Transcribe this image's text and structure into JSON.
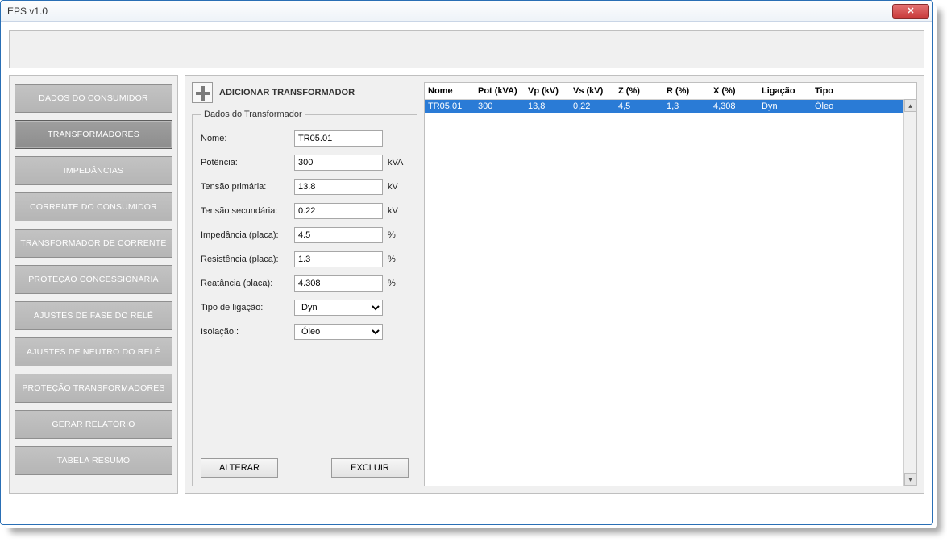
{
  "window": {
    "title": "EPS v1.0"
  },
  "sidebar": {
    "items": [
      {
        "label": "DADOS DO CONSUMIDOR",
        "active": false
      },
      {
        "label": "TRANSFORMADORES",
        "active": true
      },
      {
        "label": "IMPEDÂNCIAS",
        "active": false
      },
      {
        "label": "CORRENTE DO CONSUMIDOR",
        "active": false
      },
      {
        "label": "TRANSFORMADOR DE CORRENTE",
        "active": false
      },
      {
        "label": "PROTEÇÃO CONCESSIONÁRIA",
        "active": false
      },
      {
        "label": "AJUSTES DE FASE DO RELÉ",
        "active": false
      },
      {
        "label": "AJUSTES DE NEUTRO DO RELÉ",
        "active": false
      },
      {
        "label": "PROTEÇÃO TRANSFORMADORES",
        "active": false
      },
      {
        "label": "GERAR RELATÓRIO",
        "active": false
      },
      {
        "label": "TABELA RESUMO",
        "active": false
      }
    ]
  },
  "form": {
    "add_label": "ADICIONAR TRANSFORMADOR",
    "group_title": "Dados do Transformador",
    "fields": {
      "nome": {
        "label": "Nome:",
        "value": "TR05.01",
        "unit": ""
      },
      "potencia": {
        "label": "Potência:",
        "value": "300",
        "unit": "kVA"
      },
      "tprim": {
        "label": "Tensão primária:",
        "value": "13.8",
        "unit": "kV"
      },
      "tsec": {
        "label": "Tensão secundária:",
        "value": "0.22",
        "unit": "kV"
      },
      "imp": {
        "label": "Impedância (placa):",
        "value": "4.5",
        "unit": "%"
      },
      "res": {
        "label": "Resistência (placa):",
        "value": "1.3",
        "unit": "%"
      },
      "reat": {
        "label": "Reatância (placa):",
        "value": "4.308",
        "unit": "%"
      },
      "ligacao": {
        "label": "Tipo de ligação:",
        "value": "Dyn",
        "unit": ""
      },
      "isolacao": {
        "label": "Isolação::",
        "value": "Óleo",
        "unit": ""
      }
    },
    "buttons": {
      "alterar": "ALTERAR",
      "excluir": "EXCLUIR"
    }
  },
  "table": {
    "headers": [
      "Nome",
      "Pot (kVA)",
      "Vp (kV)",
      "Vs (kV)",
      "Z (%)",
      "R (%)",
      "X (%)",
      "Ligação",
      "Tipo"
    ],
    "rows": [
      {
        "selected": true,
        "cells": [
          "TR05.01",
          "300",
          "13,8",
          "0,22",
          "4,5",
          "1,3",
          "4,308",
          "Dyn",
          "Óleo"
        ]
      }
    ]
  }
}
